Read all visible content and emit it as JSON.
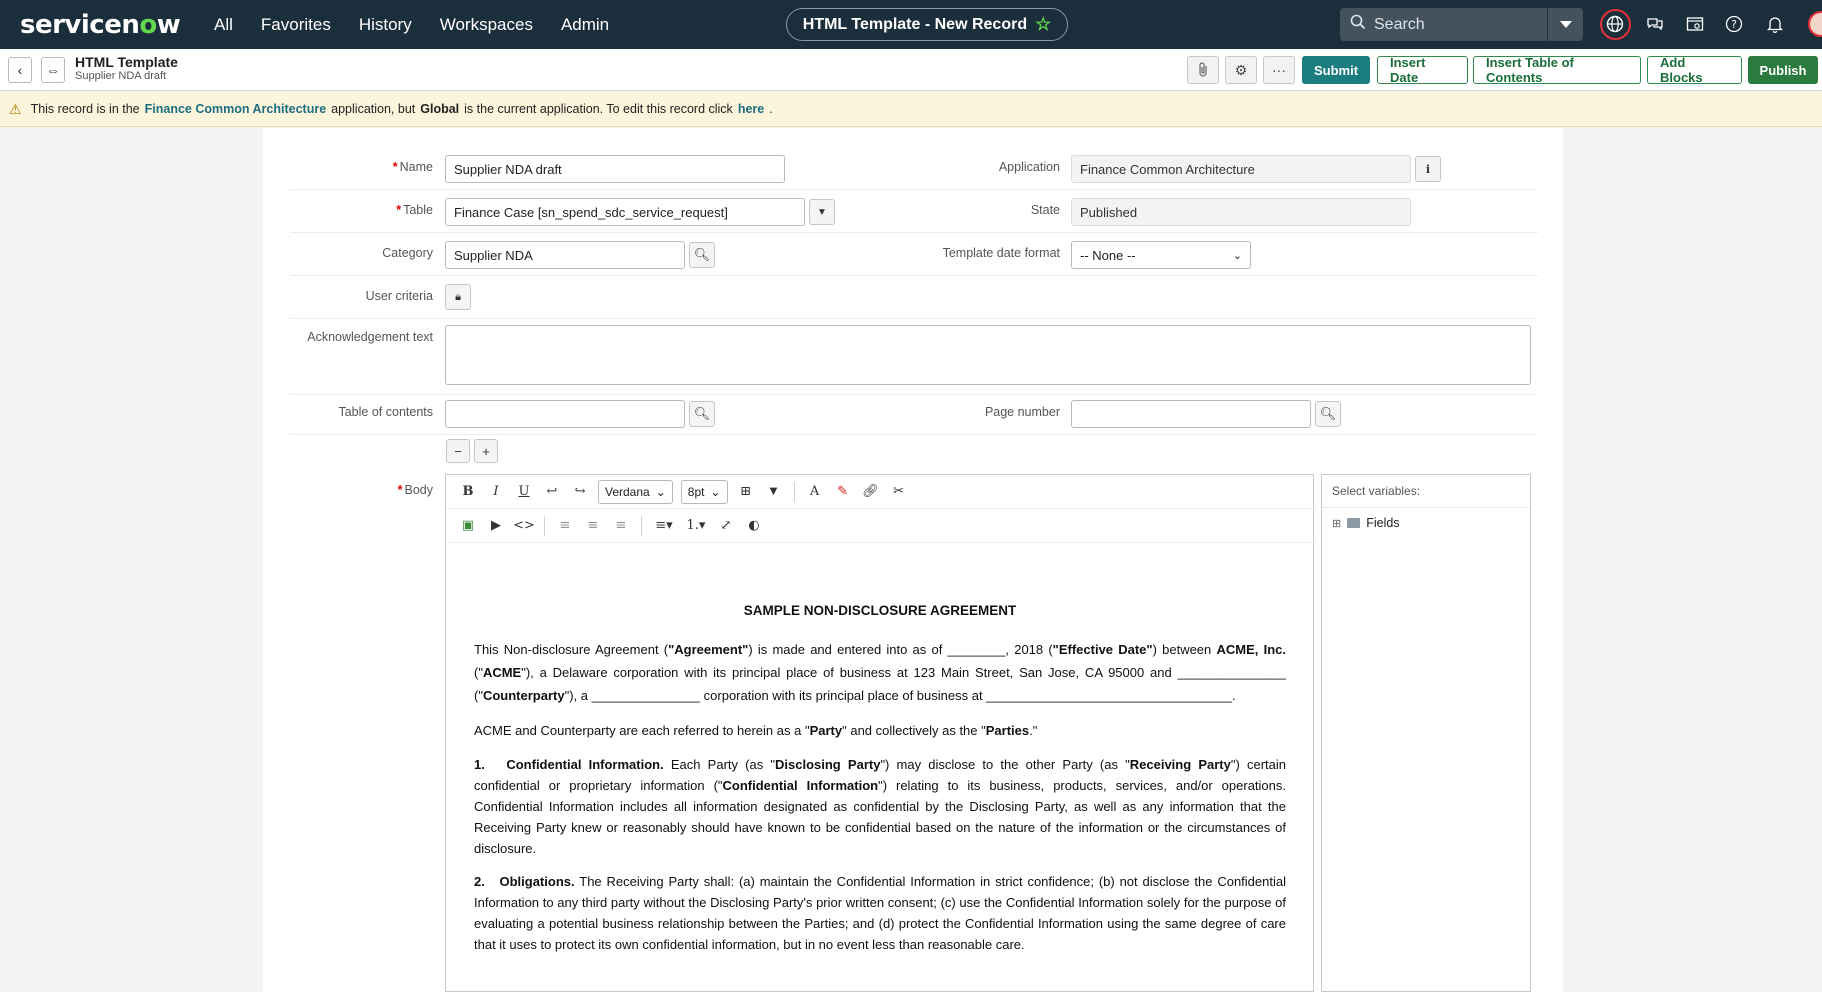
{
  "topnav": {
    "logo": "servicenow",
    "items": [
      "All",
      "Favorites",
      "History",
      "Workspaces",
      "Admin"
    ],
    "title": "HTML Template - New Record",
    "search_placeholder": "Search"
  },
  "header": {
    "title": "HTML Template",
    "subtitle": "Supplier NDA draft",
    "submit": "Submit",
    "insert_date": "Insert Date",
    "insert_toc": "Insert Table of Contents",
    "add_blocks": "Add Blocks",
    "publish": "Publish",
    "colors": {
      "submit": "#1b7d7f",
      "publish": "#2b7a3e",
      "nav": "#1b2e3c"
    }
  },
  "banner": {
    "text1": "This record is in the",
    "app_link": "Finance Common Architecture",
    "text2": "application, but",
    "current": "Global",
    "text3": "is the current application. To edit this record click",
    "here": "here",
    "text4": "."
  },
  "form": {
    "name_label": "Name",
    "name_value": "Supplier NDA draft",
    "table_label": "Table",
    "table_value": "Finance Case [sn_spend_sdc_service_request]",
    "category_label": "Category",
    "category_value": "Supplier NDA",
    "user_criteria_label": "User criteria",
    "ack_label": "Acknowledgement text",
    "ack_value": "",
    "toc_label": "Table of contents",
    "toc_value": "",
    "application_label": "Application",
    "application_value": "Finance Common Architecture",
    "state_label": "State",
    "state_value": "Published",
    "date_format_label": "Template date format",
    "date_format_value": "-- None --",
    "page_number_label": "Page number",
    "page_number_value": "",
    "body_label": "Body"
  },
  "editor": {
    "font": "Verdana",
    "size": "8pt",
    "doc_title": "SAMPLE NON-DISCLOSURE AGREEMENT",
    "p1": {
      "a": "This Non-disclosure Agreement (",
      "b": "\"Agreement\"",
      "c": ") is made and entered into as of ________, 2018 (",
      "d": "\"Effective Date\"",
      "e": ") between ",
      "f": "ACME, Inc.",
      "g": " (\"",
      "h": "ACME",
      "i": "\"), a Delaware corporation with its principal place of business at 123 Main Street, San Jose, CA 95000 and _______________ (\"",
      "j": "Counterparty",
      "k": "\"), a _______________ corporation with its principal place of business at __________________________________."
    },
    "p2": {
      "a": "ACME and Counterparty are each referred to herein as a \"",
      "b": "Party",
      "c": "\" and collectively as the \"",
      "d": "Parties",
      "e": ".\""
    },
    "p3": {
      "num": "1.",
      "head": "Confidential Information.",
      "a": " Each Party (as \"",
      "b": "Disclosing Party",
      "c": "\") may disclose to the other Party (as \"",
      "d": "Receiving Party",
      "e": "\") certain confidential or proprietary information (\"",
      "f": "Confidential Information",
      "g": "\") relating to its business, products, services, and/or operations. Confidential Information includes all information designated as confidential by the Disclosing Party, as well as any information that the Receiving Party knew or reasonably should have known to be confidential based on the nature of the information or the circumstances of disclosure."
    },
    "p4": {
      "num": "2.",
      "head": "Obligations.",
      "a": " The Receiving Party shall: (a) maintain the Confidential Information in strict confidence; (b) not disclose the Confidential Information to any third party without the Disclosing Party's prior written consent; (c) use the Confidential Information solely for the purpose of evaluating a potential business relationship between the Parties; and (d) protect the Confidential Information using the same degree of care that it uses to protect its own confidential information, but in no event less than reasonable care."
    }
  },
  "variables": {
    "title": "Select variables:",
    "item": "Fields"
  }
}
